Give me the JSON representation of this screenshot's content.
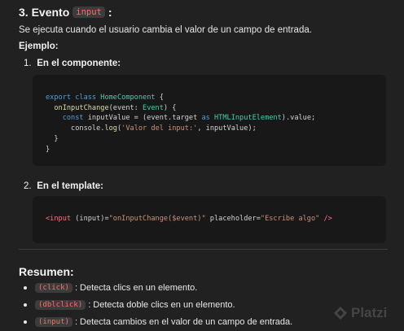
{
  "section": {
    "title_prefix": "3. Evento",
    "title_code": "input",
    "title_suffix": ":",
    "description": "Se ejecuta cuando el usuario cambia el valor de un campo de entrada.",
    "example_label": "Ejemplo:"
  },
  "steps": [
    {
      "num": "1.",
      "label": "En el componente:"
    },
    {
      "num": "2.",
      "label": "En el template:"
    }
  ],
  "code_component": {
    "l1_kw": "export class",
    "l1_cls": "HomeComponent",
    "l1_rest": " {",
    "l2_fn": "onInputChange",
    "l2_params": "(event: ",
    "l2_type": "Event",
    "l2_rest": ") {",
    "l3_kw": "const",
    "l3_mid": " inputValue = (event.target ",
    "l3_as": "as",
    "l3_type": "HTMLInputElement",
    "l3_rest": ").value;",
    "l4_obj": "console.",
    "l4_fn": "log",
    "l4_open": "(",
    "l4_str": "'Valor del input:'",
    "l4_rest": ", inputValue);",
    "l5": "}",
    "l6": "}"
  },
  "code_template": {
    "tag_open": "<input",
    "attr1": " (input)=",
    "val1": "\"onInputChange($event)\"",
    "attr2": " placeholder=",
    "val2": "\"Escribe algo\"",
    "tag_close": " />"
  },
  "summary": {
    "title": "Resumen:",
    "items": [
      {
        "code": "(click)",
        "text": ": Detecta clics en un elemento."
      },
      {
        "code": "(dblclick)",
        "text": ": Detecta doble clics en un elemento."
      },
      {
        "code": "(input)",
        "text": ": Detecta cambios en el valor de un campo de entrada."
      }
    ]
  },
  "watermark": {
    "text": "Platzi"
  }
}
